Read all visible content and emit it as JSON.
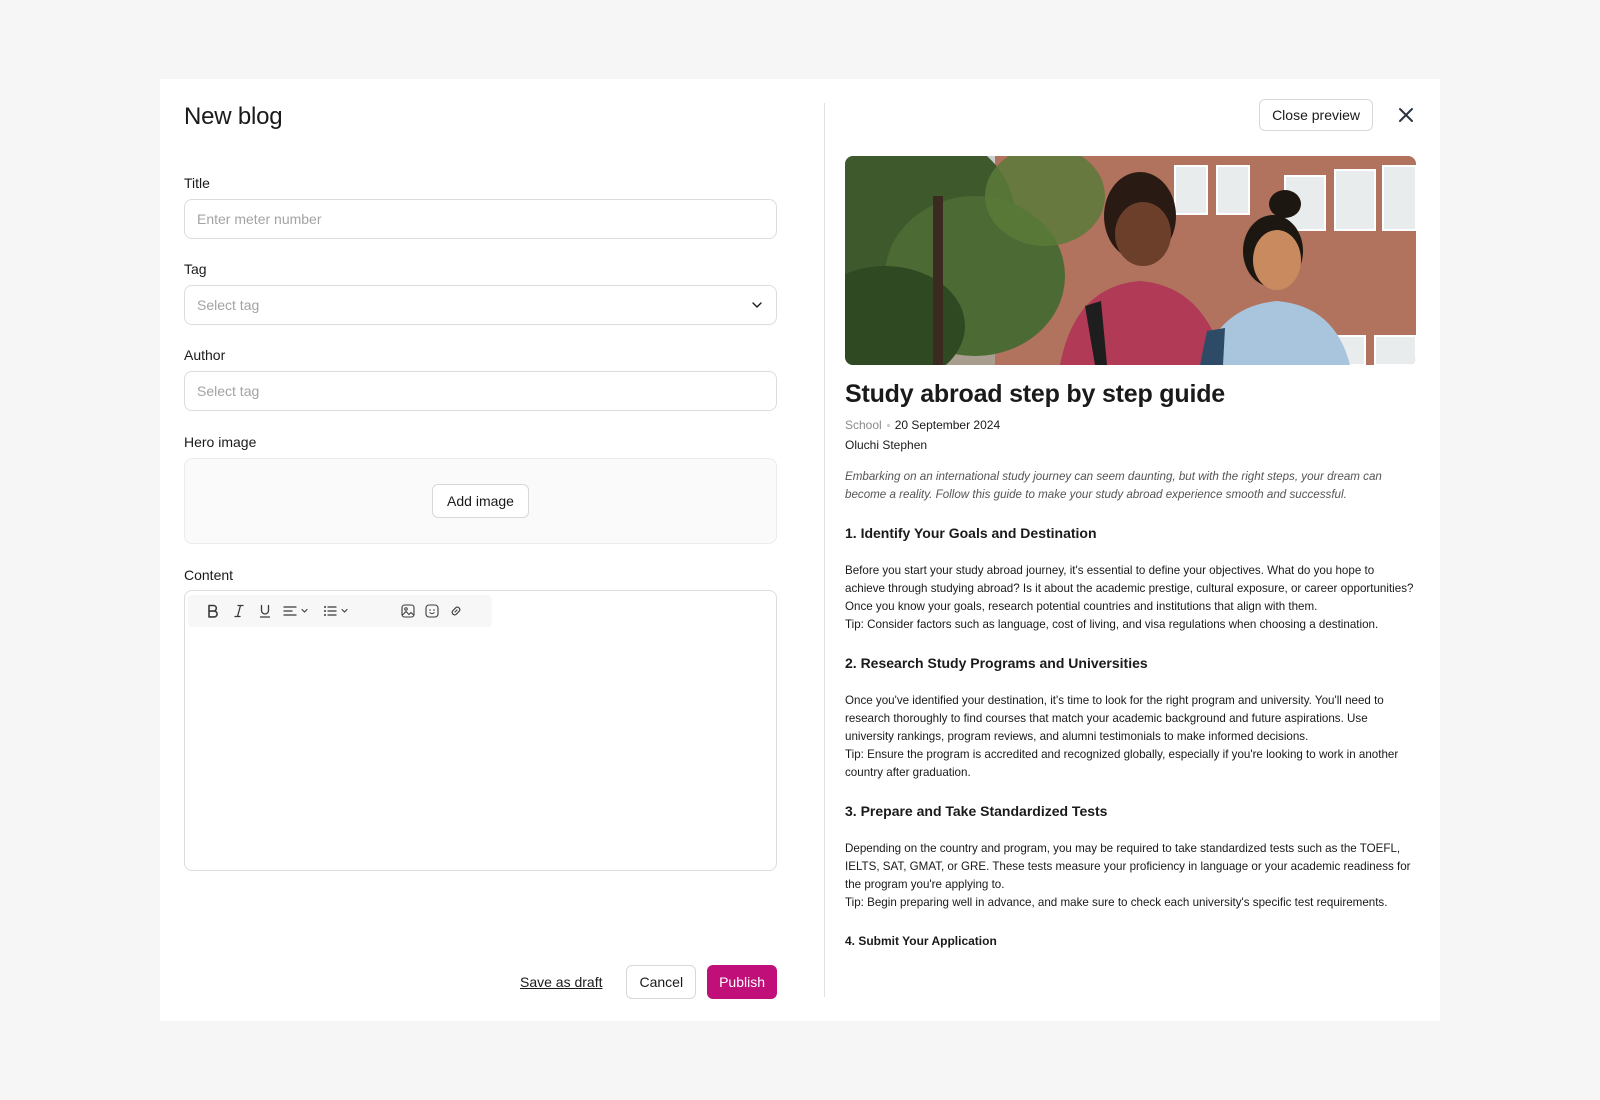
{
  "form": {
    "heading": "New blog",
    "title_label": "Title",
    "title_placeholder": "Enter meter number",
    "tag_label": "Tag",
    "tag_placeholder": "Select tag",
    "author_label": "Author",
    "author_placeholder": "Select tag",
    "hero_label": "Hero image",
    "add_image_label": "Add image",
    "content_label": "Content",
    "toolbar_icons": [
      "bold-icon",
      "italic-icon",
      "underline-icon",
      "align-left-icon",
      "bullet-list-icon",
      "image-icon",
      "emoji-icon",
      "link-icon"
    ]
  },
  "actions": {
    "save_draft": "Save as draft",
    "cancel": "Cancel",
    "publish": "Publish",
    "publish_color": "#c10f7a"
  },
  "preview": {
    "close_preview": "Close preview",
    "title": "Study abroad step by step guide",
    "tag": "School",
    "date": "20 September 2024",
    "author": "Oluchi Stephen",
    "intro": "Embarking on an international study journey can seem daunting, but with the right steps, your dream can become a reality. Follow this guide to make your study abroad experience smooth and successful.",
    "sections": [
      {
        "heading": "1. Identify Your Goals and Destination",
        "body": "Before you start your study abroad journey, it's essential to define your objectives. What do you hope to achieve through studying abroad? Is it about the academic prestige, cultural exposure, or career opportunities? Once you know your goals, research potential countries and institutions that align with them.",
        "tip": "Tip: Consider factors such as language, cost of living, and visa regulations when choosing a destination."
      },
      {
        "heading": "2. Research Study Programs and Universities",
        "body": "Once you've identified your destination, it's time to look for the right program and university. You'll need to research thoroughly to find courses that match your academic background and future aspirations. Use university rankings, program reviews, and alumni testimonials to make informed decisions.",
        "tip": "Tip: Ensure the program is accredited and recognized globally, especially if you're looking to work in another country after graduation."
      },
      {
        "heading": "3. Prepare and Take Standardized Tests",
        "body": "Depending on the country and program, you may be required to take standardized tests such as the TOEFL, IELTS, SAT, GMAT, or GRE. These tests measure your proficiency in language or your academic readiness for the program you're applying to.",
        "tip": "Tip: Begin preparing well in advance, and make sure to check each university's specific test requirements."
      }
    ],
    "next_section_heading": "4. Submit Your Application"
  }
}
